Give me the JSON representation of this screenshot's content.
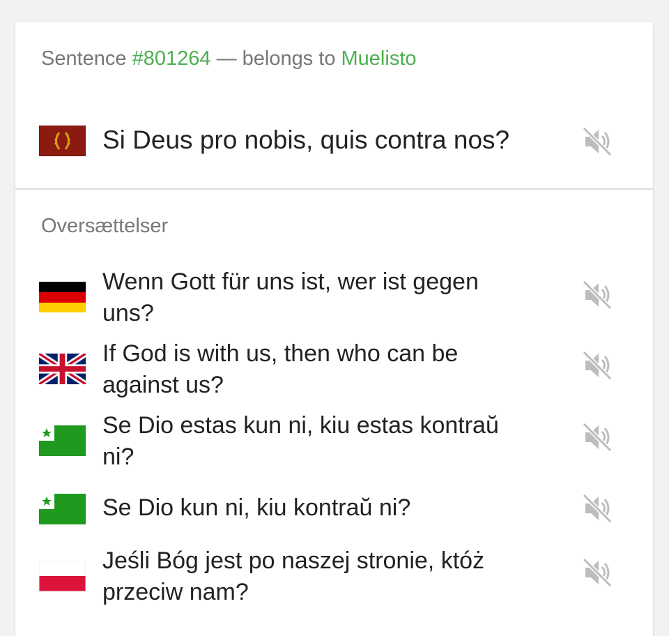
{
  "header": {
    "prefix": "Sentence ",
    "sentence_id": "#801264",
    "middle": " — belongs to ",
    "owner": "Muelisto"
  },
  "main_sentence": {
    "text": "Si Deus pro nobis, quis contra nos?",
    "flag": "latin-flag-icon"
  },
  "translations_label": "Oversættelser",
  "translations": [
    {
      "text": "Wenn Gott für uns ist, wer ist gegen uns?",
      "flag": "german-flag-icon"
    },
    {
      "text": "If God is with us, then who can be against us?",
      "flag": "uk-flag-icon"
    },
    {
      "text": "Se Dio estas kun ni, kiu estas kontraŭ ni?",
      "flag": "esperanto-flag-icon"
    },
    {
      "text": "Se Dio kun ni, kiu kontraŭ ni?",
      "flag": "esperanto-flag-icon"
    },
    {
      "text": "Jeśli Bóg jest po naszej stronie, któż przeciw nam?",
      "flag": "polish-flag-icon"
    }
  ],
  "icons": {
    "audio": "audio-unavailable-icon"
  },
  "colors": {
    "link": "#4caf50",
    "muted_text": "#777777",
    "body_text": "#222222",
    "icon_gray": "#bdbdbd"
  }
}
